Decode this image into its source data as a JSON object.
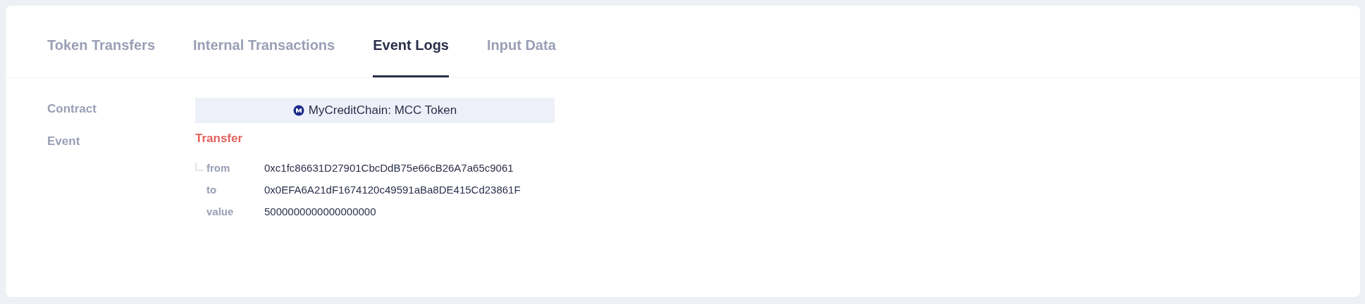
{
  "tabs": [
    {
      "label": "Token Transfers",
      "selected": false
    },
    {
      "label": "Internal Transactions",
      "selected": false
    },
    {
      "label": "Event Logs",
      "selected": true
    },
    {
      "label": "Input Data",
      "selected": false
    }
  ],
  "log": {
    "contract_label": "Contract",
    "contract": "MyCreditChain: MCC Token",
    "event_label": "Event",
    "event_name": "Transfer",
    "params": [
      {
        "name": "from",
        "value": "0xc1fc86631D27901CbcDdB75e66cB26A7a65c9061"
      },
      {
        "name": "to",
        "value": "0x0EFA6A21dF1674120c49591aBa8DE415Cd23861F"
      },
      {
        "name": "value",
        "value": "5000000000000000000"
      }
    ]
  }
}
